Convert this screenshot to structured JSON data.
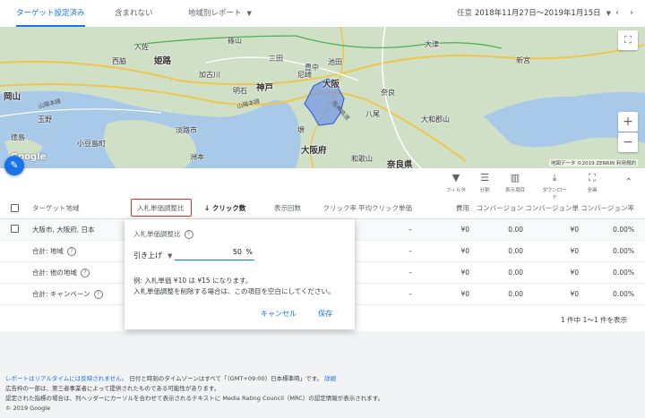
{
  "tabs": [
    {
      "label": "ターゲット設定済み"
    },
    {
      "label": "含まれない"
    },
    {
      "label": "地域別レポート"
    }
  ],
  "date": {
    "label": "任意",
    "range": "2018年11月27日〜2019年1月15日"
  },
  "map": {
    "labels": [
      "入佐",
      "篠山",
      "西脇",
      "姫路",
      "加古川",
      "明石",
      "神戸",
      "尼崎",
      "大阪",
      "豊中",
      "奈良",
      "堺",
      "大阪府",
      "奈良県",
      "和歌山",
      "岡山",
      "玉野",
      "小豆島町",
      "洲本",
      "淡路市",
      "徳島",
      "三田",
      "新宮",
      "池田",
      "八尾",
      "大和郡山",
      "大津"
    ],
    "road_labels": [
      "山陽本線",
      "山陽本線",
      "阪神高速"
    ],
    "attribution": "地図データ ©2019 ZENRIN  利用規約",
    "logo": "Google"
  },
  "toolbar": [
    {
      "icon": "filter",
      "label": "フィルタ"
    },
    {
      "icon": "segment",
      "label": "分割"
    },
    {
      "icon": "columns",
      "label": "表示項目"
    },
    {
      "icon": "download",
      "label": "ダウンロード"
    },
    {
      "icon": "expand",
      "label": "全画"
    }
  ],
  "table": {
    "headers": {
      "location": "ターゲット地域",
      "bid_adj": "入札単価調整比",
      "clicks": "クリック数",
      "impr": "表示回数",
      "ctr": "クリック率",
      "avg_cpc": "平均クリック単価",
      "cost": "費用",
      "conv": "コンバージョン",
      "cost_conv": "コンバージョン単価",
      "conv_rate": "コンバージョン率"
    },
    "rows": [
      {
        "name": "大阪市, 大阪府, 日本",
        "dash": "–",
        "cost": "¥0",
        "conv": "0.00",
        "cost_conv": "¥0",
        "conv_rate": "0.00%"
      },
      {
        "name": "合計: 地域",
        "dash": "–",
        "cost": "¥0",
        "conv": "0.00",
        "cost_conv": "¥0",
        "conv_rate": "0.00%"
      },
      {
        "name": "合計: 他の地域",
        "dash": "–",
        "cost": "¥0",
        "conv": "0.00",
        "cost_conv": "¥0",
        "conv_rate": "0.00%"
      },
      {
        "name": "合計: キャンペーン",
        "dash": "–",
        "cost": "¥0",
        "conv": "0.00",
        "cost_conv": "¥0",
        "conv_rate": "0.00%"
      }
    ],
    "pager": "1 件中 1〜1 件を表示"
  },
  "popup": {
    "title": "入札単価調整比",
    "mode": "引き上げ",
    "value": "50",
    "unit": "%",
    "example1": "例: 入札単価 ¥10 は ¥15 になります。",
    "example2": "入札単価調整を削除する場合は、この項目を空白にしてください。",
    "cancel": "キャンセル",
    "save": "保存"
  },
  "footer": {
    "line1_link": "レポートはリアルタイムには反映されません。",
    "line1_text": "日付と時刻のタイムゾーンはすべて「（GMT+09:00）日本標準時」です。",
    "line1_more": "詳細",
    "line2": "広告枠の一部は、第三者事業者によって提供されたものである可能性があります。",
    "line3": "認定された指標の場合は、列ヘッダーにカーソルを合わせて表示されるテキストに Media Rating Council（MRC）の認定情報が表示されます。",
    "copyright": "© 2019 Google"
  },
  "colors": {
    "accent": "#1a73e8",
    "highlight": "#d93025"
  }
}
